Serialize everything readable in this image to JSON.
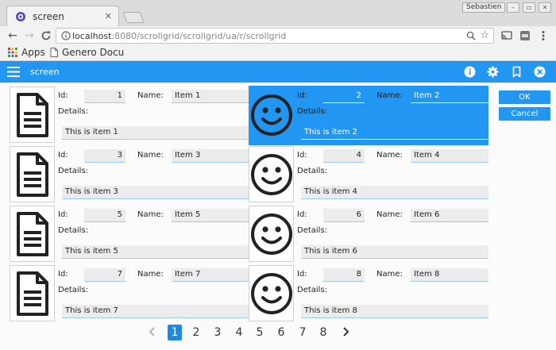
{
  "browser": {
    "tab_title": "screen",
    "tab_close": "✕",
    "user_name": "Sebastien",
    "window_controls": [
      "–",
      "▭",
      "✕"
    ],
    "url_host": "localhost",
    "url_rest": ":8080/scrollgrid/scrollgrid/ua/r/scrollgrid",
    "bookmarks": [
      "Apps",
      "Genero Docu"
    ]
  },
  "app": {
    "title": "screen",
    "accent_color": "#2196f3",
    "header_icons": [
      "info-icon",
      "settings-gear-icon",
      "bookmark-icon",
      "close-circle-icon"
    ]
  },
  "labels": {
    "id": "Id:",
    "name": "Name:",
    "details": "Details:"
  },
  "records": [
    {
      "id": "1",
      "name": "Item 1",
      "details": "This is item 1",
      "icon": "document-icon",
      "selected": false
    },
    {
      "id": "2",
      "name": "Item 2",
      "details": "This is item 2",
      "icon": "smiley-icon",
      "selected": true
    },
    {
      "id": "3",
      "name": "Item 3",
      "details": "This is item 3",
      "icon": "document-icon",
      "selected": false
    },
    {
      "id": "4",
      "name": "Item 4",
      "details": "This is item 4",
      "icon": "smiley-icon",
      "selected": false
    },
    {
      "id": "5",
      "name": "Item 5",
      "details": "This is item 5",
      "icon": "document-icon",
      "selected": false
    },
    {
      "id": "6",
      "name": "Item 6",
      "details": "This is item 6",
      "icon": "smiley-icon",
      "selected": false
    },
    {
      "id": "7",
      "name": "Item 7",
      "details": "This is item 7",
      "icon": "document-icon",
      "selected": false
    },
    {
      "id": "8",
      "name": "Item 8",
      "details": "This is item 8",
      "icon": "smiley-icon",
      "selected": false
    }
  ],
  "actions": {
    "ok": "OK",
    "cancel": "Cancel"
  },
  "pager": {
    "pages": [
      "1",
      "2",
      "3",
      "4",
      "5",
      "6",
      "7",
      "8"
    ],
    "current": "1"
  }
}
